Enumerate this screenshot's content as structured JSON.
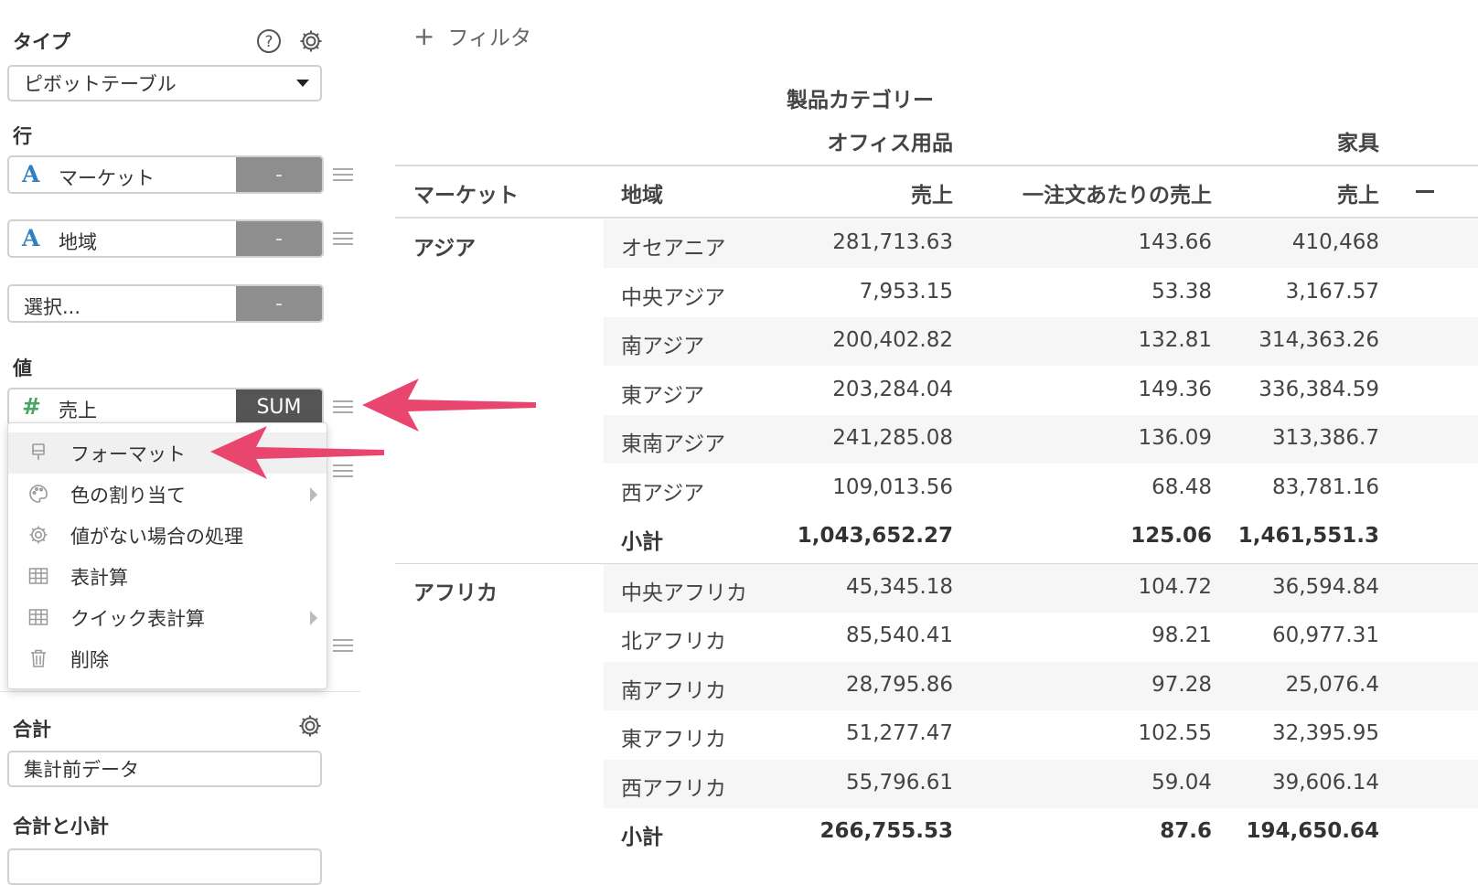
{
  "sidebar": {
    "type_label": "タイプ",
    "type_value": "ピボットテーブル",
    "rows_label": "行",
    "row_fields": [
      {
        "icon": "A",
        "name": "マーケット",
        "agg": "-"
      },
      {
        "icon": "A",
        "name": "地域",
        "agg": "-"
      },
      {
        "icon": "",
        "name": "選択...",
        "agg": "-"
      }
    ],
    "values_label": "値",
    "value_field": {
      "icon": "#",
      "name": "売上",
      "agg": "SUM"
    },
    "menu": [
      {
        "icon": "paint-brush-icon",
        "label": "フォーマット"
      },
      {
        "icon": "palette-icon",
        "label": "色の割り当て"
      },
      {
        "icon": "gear-icon",
        "label": "値がない場合の処理"
      },
      {
        "icon": "table-icon",
        "label": "表計算"
      },
      {
        "icon": "table-icon",
        "label": "クイック表計算"
      },
      {
        "icon": "trash-icon",
        "label": "削除"
      }
    ],
    "total_label": "合計",
    "total_value": "集計前データ",
    "total_subtotal_label": "合計と小計"
  },
  "filter_label": "フィルタ",
  "table": {
    "group_header": "製品カテゴリー",
    "category_1": "オフィス用品",
    "category_2": "家具",
    "columns": [
      "マーケット",
      "地域",
      "売上",
      "一注文あたりの売上",
      "売上"
    ],
    "groups": [
      {
        "market": "アジア",
        "rows": [
          {
            "region": "オセアニア",
            "sales": "281,713.63",
            "per_order": "143.66",
            "furn_sales": "410,468"
          },
          {
            "region": "中央アジア",
            "sales": "7,953.15",
            "per_order": "53.38",
            "furn_sales": "3,167.57"
          },
          {
            "region": "南アジア",
            "sales": "200,402.82",
            "per_order": "132.81",
            "furn_sales": "314,363.26"
          },
          {
            "region": "東アジア",
            "sales": "203,284.04",
            "per_order": "149.36",
            "furn_sales": "336,384.59"
          },
          {
            "region": "東南アジア",
            "sales": "241,285.08",
            "per_order": "136.09",
            "furn_sales": "313,386.7"
          },
          {
            "region": "西アジア",
            "sales": "109,013.56",
            "per_order": "68.48",
            "furn_sales": "83,781.16"
          },
          {
            "region": "小計",
            "sales": "1,043,652.27",
            "per_order": "125.06",
            "furn_sales": "1,461,551.3"
          }
        ]
      },
      {
        "market": "アフリカ",
        "rows": [
          {
            "region": "中央アフリカ",
            "sales": "45,345.18",
            "per_order": "104.72",
            "furn_sales": "36,594.84"
          },
          {
            "region": "北アフリカ",
            "sales": "85,540.41",
            "per_order": "98.21",
            "furn_sales": "60,977.31"
          },
          {
            "region": "南アフリカ",
            "sales": "28,795.86",
            "per_order": "97.28",
            "furn_sales": "25,076.4"
          },
          {
            "region": "東アフリカ",
            "sales": "51,277.47",
            "per_order": "102.55",
            "furn_sales": "32,395.95"
          },
          {
            "region": "西アフリカ",
            "sales": "55,796.61",
            "per_order": "59.04",
            "furn_sales": "39,606.14"
          },
          {
            "region": "小計",
            "sales": "266,755.53",
            "per_order": "87.6",
            "furn_sales": "194,650.64"
          }
        ]
      }
    ]
  },
  "colors": {
    "accent_arrow": "#e8456f",
    "string_type": "#2e7fc4",
    "number_type": "#4aa564"
  }
}
